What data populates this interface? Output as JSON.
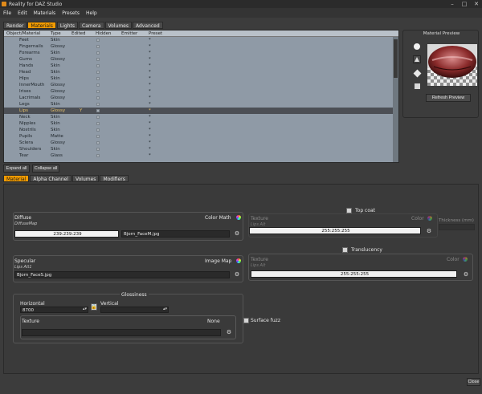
{
  "window": {
    "title": "Reality for DAZ Studio",
    "minimize": "–",
    "maximize": "□",
    "close": "✕"
  },
  "menu": [
    "File",
    "Edit",
    "Materials",
    "Presets",
    "Help"
  ],
  "top_tabs": [
    "Render",
    "Materials",
    "Lights",
    "Camera",
    "Volumes",
    "Advanced"
  ],
  "table": {
    "headers": [
      "Object/Material",
      "Type",
      "Edited",
      "Hidden",
      "Emitter",
      "Preset"
    ],
    "rows": [
      {
        "name": "Feet",
        "type": "Skin",
        "edited": "",
        "preset": "*"
      },
      {
        "name": "Fingernails",
        "type": "Glossy",
        "edited": "",
        "preset": "*"
      },
      {
        "name": "Forearms",
        "type": "Skin",
        "edited": "",
        "preset": "*"
      },
      {
        "name": "Gums",
        "type": "Glossy",
        "edited": "",
        "preset": "*"
      },
      {
        "name": "Hands",
        "type": "Skin",
        "edited": "",
        "preset": "*"
      },
      {
        "name": "Head",
        "type": "Skin",
        "edited": "",
        "preset": "*"
      },
      {
        "name": "Hips",
        "type": "Skin",
        "edited": "",
        "preset": "*"
      },
      {
        "name": "InnerMouth",
        "type": "Glossy",
        "edited": "",
        "preset": "*"
      },
      {
        "name": "Irises",
        "type": "Glossy",
        "edited": "",
        "preset": "*"
      },
      {
        "name": "Lacrimals",
        "type": "Glossy",
        "edited": "",
        "preset": "*"
      },
      {
        "name": "Legs",
        "type": "Skin",
        "edited": "",
        "preset": "*"
      },
      {
        "name": "Lips",
        "type": "Glossy",
        "edited": "Y",
        "preset": "*",
        "selected": true
      },
      {
        "name": "Neck",
        "type": "Skin",
        "edited": "",
        "preset": "*"
      },
      {
        "name": "Nipples",
        "type": "Skin",
        "edited": "",
        "preset": "*"
      },
      {
        "name": "Nostrils",
        "type": "Skin",
        "edited": "",
        "preset": "*"
      },
      {
        "name": "Pupils",
        "type": "Matte",
        "edited": "",
        "preset": "*"
      },
      {
        "name": "Sclera",
        "type": "Glossy",
        "edited": "",
        "preset": "*"
      },
      {
        "name": "Shoulders",
        "type": "Skin",
        "edited": "",
        "preset": "*"
      },
      {
        "name": "Tear",
        "type": "Glass",
        "edited": "",
        "preset": "*"
      }
    ]
  },
  "buttons": {
    "expand_all": "Expand all",
    "collapse_all": "Collapse all",
    "refresh_preview": "Refresh Preview",
    "close": "Close"
  },
  "preview": {
    "title": "Material Preview"
  },
  "material_tabs": [
    "Material",
    "Alpha Channel",
    "Volumes",
    "Modifiers"
  ],
  "diffuse": {
    "label": "Diffuse",
    "sublabel": "DiffuseMap",
    "mode": "Color Math",
    "color_value": "239:239:239",
    "texture": "Bjorn_FaceM.jpg"
  },
  "specular": {
    "label": "Specular",
    "sublabel": "Lips Alt1",
    "mode": "Image Map",
    "texture": "Bjorn_FaceS.jpg"
  },
  "glossiness": {
    "label": "Glossiness",
    "horizontal_label": "Horizontal",
    "horizontal_value": "8700",
    "vertical_label": "Vertical",
    "vertical_value": "",
    "texture_label": "Texture",
    "texture_mode": "None"
  },
  "surface_fuzz": {
    "label": "Surface fuzz"
  },
  "top_coat": {
    "label": "Top coat",
    "texture_label": "Texture",
    "sublabel": "Lips Alt",
    "color_label": "Color",
    "value": "255:255:255",
    "thickness_label": "Thickness (mm)"
  },
  "translucency": {
    "label": "Translucency",
    "texture_label": "Texture",
    "sublabel": "Lips Alt",
    "color_label": "Color",
    "value": "255:255:255"
  },
  "colors": {
    "accent": "#f29b00",
    "table_bg": "#8f9aa6",
    "panel_bg": "#3a3a3a"
  }
}
